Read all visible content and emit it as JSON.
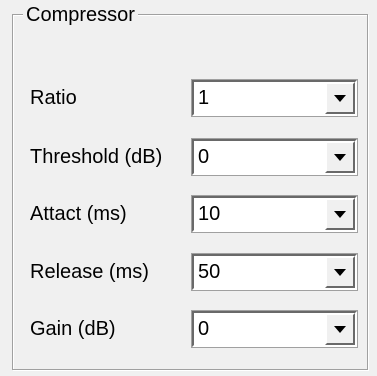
{
  "group": {
    "title": "Compressor"
  },
  "fields": [
    {
      "label": "Ratio",
      "value": "1"
    },
    {
      "label": "Threshold (dB)",
      "value": "0"
    },
    {
      "label": "Attact (ms)",
      "value": "10"
    },
    {
      "label": "Release (ms)",
      "value": "50"
    },
    {
      "label": "Gain (dB)",
      "value": "0"
    }
  ],
  "icons": {
    "dropdown": "chevron-down-icon"
  }
}
